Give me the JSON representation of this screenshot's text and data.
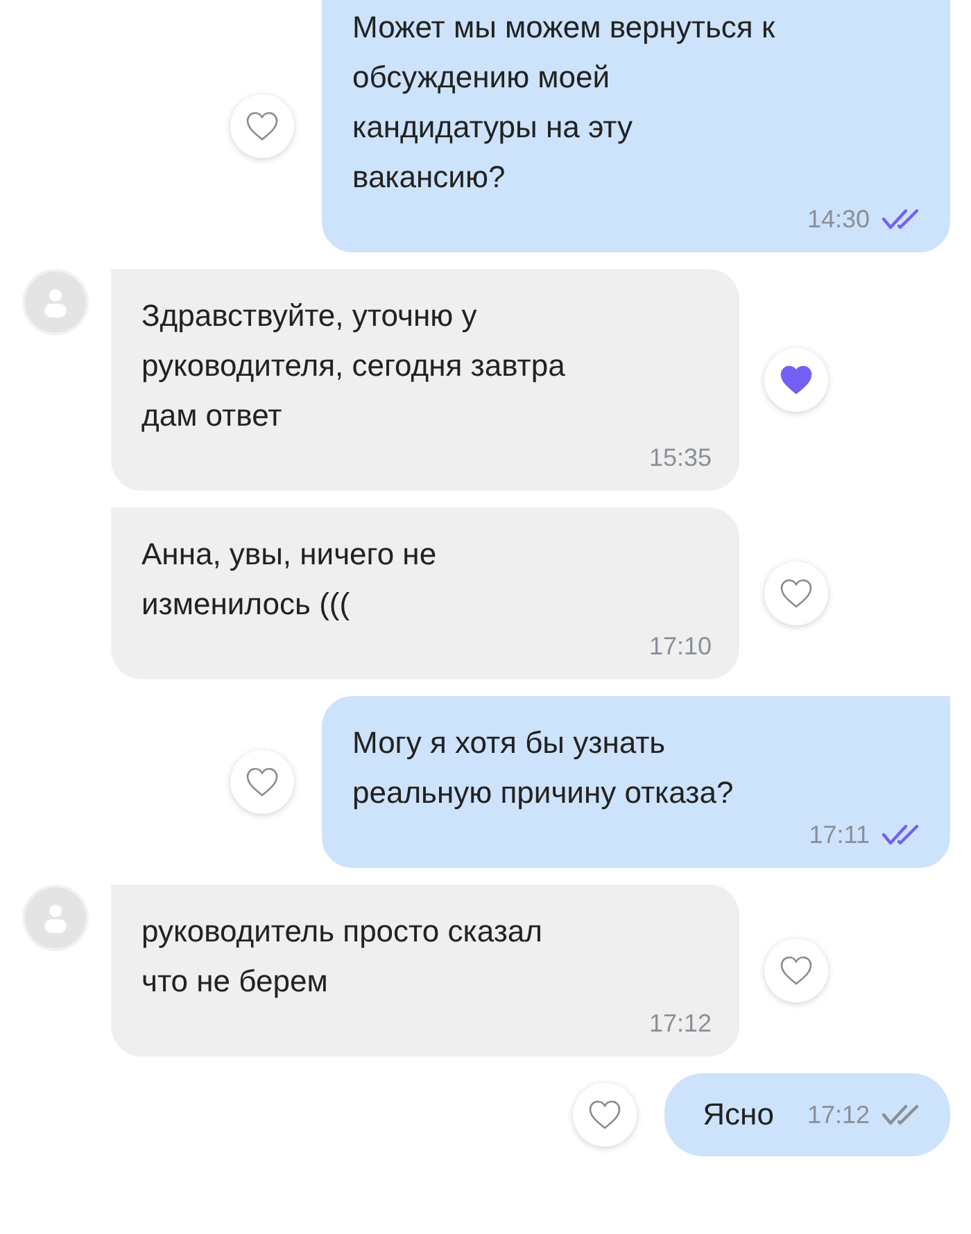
{
  "messages": [
    {
      "kind": "sent",
      "text": "Может мы можем вернуться к обсуждению моей кандидатуры на эту вакансию?",
      "time": "14:30",
      "read": true,
      "liked": false
    },
    {
      "kind": "received",
      "text": "Здравствуйте,  уточню у руководителя, сегодня завтра дам ответ",
      "time": "15:35",
      "liked": true,
      "avatar": true
    },
    {
      "kind": "received",
      "text": "Анна, увы,  ничего не изменилось (((",
      "time": "17:10",
      "liked": false,
      "avatar": false
    },
    {
      "kind": "sent",
      "text": "Могу я хотя бы узнать реальную причину отказа?",
      "time": "17:11",
      "read": true,
      "liked": false
    },
    {
      "kind": "received",
      "text": "руководитель просто сказал что не берем",
      "time": "17:12",
      "liked": false,
      "avatar": true
    },
    {
      "kind": "sent-short",
      "text": "Ясно",
      "time": "17:12",
      "read": false,
      "liked": false
    }
  ]
}
